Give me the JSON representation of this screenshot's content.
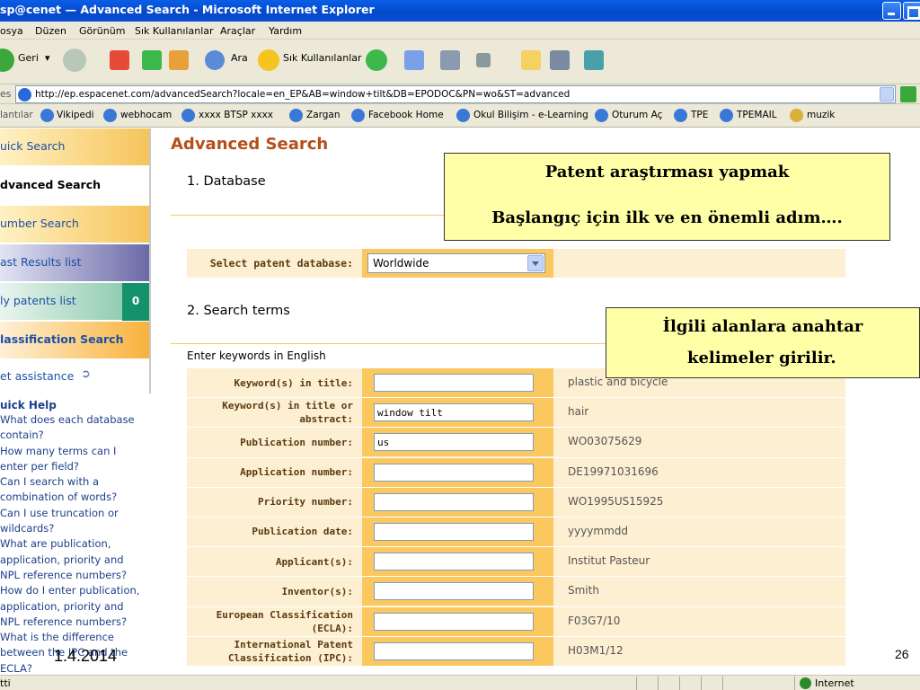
{
  "window": {
    "title": "sp@cenet — Advanced Search - Microsoft Internet Explorer"
  },
  "menu": [
    "osya",
    "Düzen",
    "Görünüm",
    "Sık Kullanılanlar",
    "Araçlar",
    "Yardım"
  ],
  "toolbar": {
    "back_label": "Geri",
    "search_label": "Ara",
    "favorites_label": "Sık Kullanılanlar"
  },
  "address": {
    "label": "es",
    "url": "http://ep.espacenet.com/advancedSearch?locale=en_EP&AB=window+tilt&DB=EPODOC&PN=wo&ST=advanced"
  },
  "links": {
    "label": "lantılar",
    "items": [
      "Vikipedi",
      "webhocam",
      "xxxx BTSP  xxxx",
      "Zargan",
      "Facebook Home",
      "Okul Bilişim - e-Learning",
      "Oturum Aç",
      "TPE",
      "TPEMAIL",
      "muzik"
    ]
  },
  "leftnav": {
    "items": [
      "uick Search",
      "dvanced Search",
      "umber Search",
      "ast Results list",
      "ly patents list",
      "lassification Search",
      "et assistance"
    ],
    "patents_count": "0"
  },
  "quick_help": {
    "title": "uick Help",
    "lines": [
      "What does each database",
      "contain?",
      "How many terms can I",
      "enter per field?",
      "Can I search with a",
      "combination of words?",
      "Can I use truncation or",
      "wildcards?",
      "What are publication,",
      "application, priority and",
      "NPL reference numbers?",
      "How do I enter publication,",
      "application, priority and",
      "NPL reference numbers?",
      "What is the difference",
      "between the IPC and the",
      "ECLA?"
    ]
  },
  "main": {
    "title": "Advanced Search",
    "section_database": "1. Database",
    "select_label": "Select patent database:",
    "database_value": "Worldwide",
    "section_terms": "2. Search terms",
    "enter_keywords": "Enter keywords in English"
  },
  "form_rows": [
    {
      "label": "Keyword(s) in title:",
      "value": "",
      "example": "plastic and bicycle"
    },
    {
      "label": "Keyword(s) in title or abstract:",
      "value": "window tilt",
      "example": "hair"
    },
    {
      "label": "Publication number:",
      "value": "us",
      "example": "WO03075629"
    },
    {
      "label": "Application number:",
      "value": "",
      "example": "DE19971031696"
    },
    {
      "label": "Priority number:",
      "value": "",
      "example": "WO1995US15925"
    },
    {
      "label": "Publication date:",
      "value": "",
      "example": "yyyymmdd"
    },
    {
      "label": "Applicant(s):",
      "value": "",
      "example": "Institut Pasteur"
    },
    {
      "label": "Inventor(s):",
      "value": "",
      "example": "Smith"
    },
    {
      "label": "European Classification (ECLA):",
      "value": "",
      "example": "F03G7/10"
    },
    {
      "label": "International Patent Classification (IPC):",
      "value": "",
      "example": "H03M1/12"
    }
  ],
  "callouts": {
    "c1_line1": "Patent araştırması yapmak",
    "c1_line2": "Başlangıç için ilk ve en önemli adım….",
    "c2_line1": "İlgili alanlara anahtar",
    "c2_line2": "kelimeler girilir."
  },
  "status": {
    "text": "tti",
    "zone": "Internet"
  },
  "slide": {
    "date": "1.4.2014",
    "number": "26"
  }
}
